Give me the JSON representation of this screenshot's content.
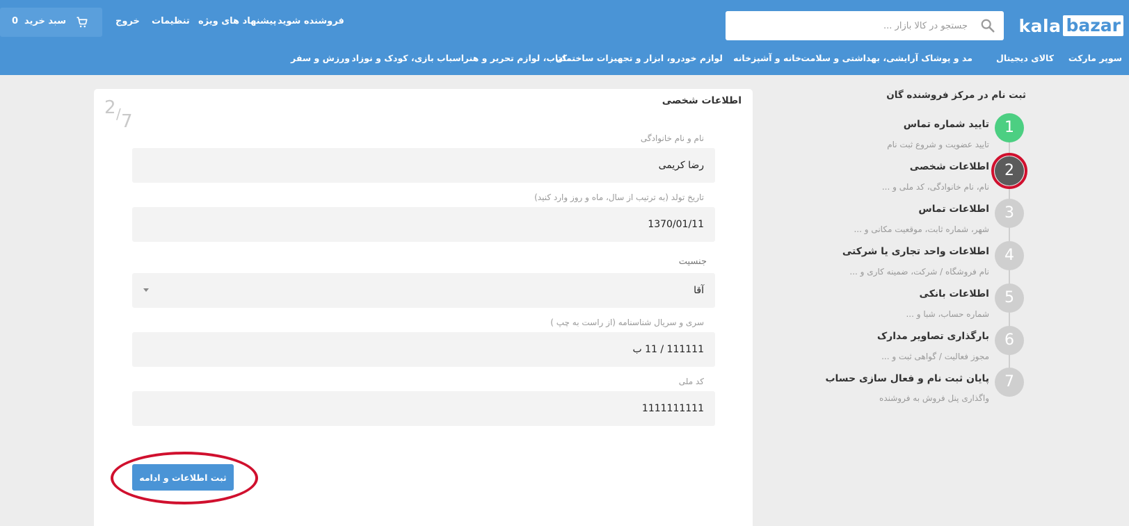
{
  "header": {
    "logo": {
      "part1": "kala",
      "part2": "bazar"
    },
    "search": {
      "placeholder": "جستجو در کالا بازار ...",
      "value": ""
    },
    "cart": {
      "label": "سبد خرید",
      "count": "0"
    },
    "links": {
      "seller": "فروشنده شوید",
      "offers": "پیشنهاد های ویژه",
      "settings": "تنظیمات",
      "logout": "خروج"
    },
    "categories": [
      "سوپر مارکت",
      "کالای دیجیتال",
      "مد و پوشاک",
      "آرایشی، بهداشتی و سلامت",
      "خانه و آشپزخانه",
      "لوازم خودرو، ابزار و تجهیزات ساختمان",
      "کتاب، لوازم تحریر و هنر",
      "اسباب بازی، کودک و نوزاد",
      "ورزش و سفر"
    ]
  },
  "sidebar": {
    "title": "ثبت نام در مرکز فروشنده گان",
    "steps": [
      {
        "num": "1",
        "title": "تایید شماره تماس",
        "subtitle": "تایید عضویت و شروع ثبت نام",
        "state": "done"
      },
      {
        "num": "2",
        "title": "اطلاعات شخصی",
        "subtitle": "نام، نام خانوادگی، کد ملی و ...",
        "state": "active"
      },
      {
        "num": "3",
        "title": "اطلاعات تماس",
        "subtitle": "شهر، شماره ثابت، موقعیت مکانی و ...",
        "state": "pending"
      },
      {
        "num": "4",
        "title": "اطلاعات واحد تجاری یا شرکتی",
        "subtitle": "نام فروشگاه / شرکت، ضمینه کاری و ...",
        "state": "pending"
      },
      {
        "num": "5",
        "title": "اطلاعات بانکی",
        "subtitle": "شماره حساب، شبا و ...",
        "state": "pending"
      },
      {
        "num": "6",
        "title": "بارگذاری تصاویر مدارک",
        "subtitle": "مجوز فعالیت / گواهی ثبت و ...",
        "state": "pending"
      },
      {
        "num": "7",
        "title": "پایان ثبت نام و فعال سازی حساب",
        "subtitle": "واگذاری پنل فروش به فروشنده",
        "state": "pending"
      }
    ]
  },
  "form": {
    "title": "اطلاعات شخصی",
    "step_current": "2",
    "step_total": "7",
    "fields": {
      "fullname": {
        "label": "نام و نام خانوادگی",
        "value": "رضا کریمی"
      },
      "birthdate": {
        "label": "تاریخ تولد (به ترتیب از سال، ماه و روز وارد کنید)",
        "value": "1370/01/11"
      },
      "gender": {
        "label": "جنسیت",
        "value": "آقا"
      },
      "id_serial": {
        "label": "سری و سریال شناسنامه (از راست به چپ )",
        "value": "111111 / 11 ب"
      },
      "national_code": {
        "label": "کد ملی",
        "value": "1111111111"
      }
    },
    "submit_label": "ثبت اطلاعات و ادامه"
  },
  "colors": {
    "header_bg": "#4a94d6",
    "step_done": "#4ccf82",
    "step_active": "#5b5b5b",
    "step_pending": "#cfcfcf",
    "highlight_ring": "#d0102e"
  }
}
